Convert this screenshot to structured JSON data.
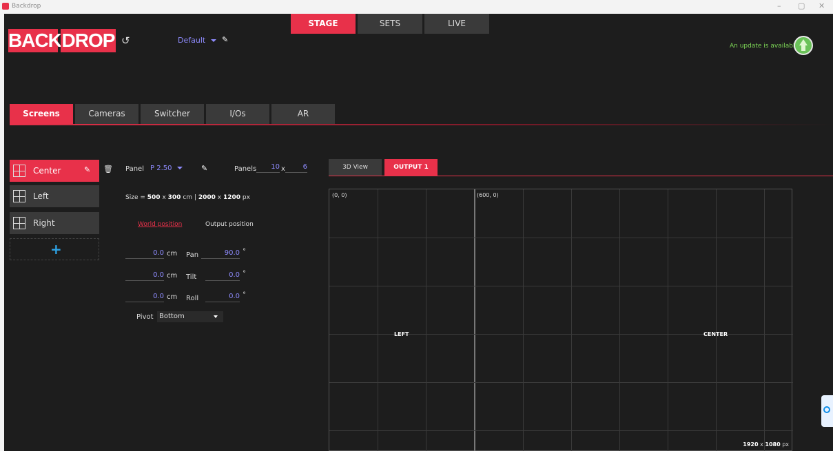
{
  "window": {
    "title": "Backdrop",
    "minimize": "–",
    "maximize": "▢",
    "close": "✕"
  },
  "header": {
    "logo_left": "BACK",
    "logo_right": "DROP",
    "preset": "Default",
    "nav": [
      {
        "label": "STAGE",
        "active": true
      },
      {
        "label": "SETS",
        "active": false
      },
      {
        "label": "LIVE",
        "active": false
      }
    ],
    "update_text": "An update is available"
  },
  "subtabs": [
    {
      "label": "Screens",
      "active": true
    },
    {
      "label": "Cameras",
      "active": false
    },
    {
      "label": "Switcher",
      "active": false
    },
    {
      "label": "I/Os",
      "active": false
    },
    {
      "label": "AR",
      "active": false
    }
  ],
  "screens": [
    {
      "label": "Center",
      "active": true
    },
    {
      "label": "Left",
      "active": false
    },
    {
      "label": "Right",
      "active": false
    }
  ],
  "add_symbol": "+",
  "panel": {
    "panel_label": "Panel",
    "panel_value": "P 2.50",
    "panels_label": "Panels",
    "panels_x": "10",
    "times": "x",
    "panels_y": "6",
    "size_prefix": "Size =",
    "size_w": "500",
    "x1": "x",
    "size_h": "300",
    "unit_cm": "cm",
    "sep": "|",
    "px_w": "2000",
    "x2": "x",
    "px_h": "1200",
    "unit_px": "px",
    "world_position": "World position",
    "output_position": "Output position",
    "rows": [
      {
        "value": "0.0",
        "unit": "cm",
        "label": "Pan",
        "angle": "90.0",
        "deg": "°"
      },
      {
        "value": "0.0",
        "unit": "cm",
        "label": "Tilt",
        "angle": "0.0",
        "deg": "°"
      },
      {
        "value": "0.0",
        "unit": "cm",
        "label": "Roll",
        "angle": "0.0",
        "deg": "°"
      }
    ],
    "pivot_label": "Pivot",
    "pivot_value": "Bottom"
  },
  "view_tabs": [
    {
      "label": "3D View",
      "active": false
    },
    {
      "label": "OUTPUT 1",
      "active": true
    }
  ],
  "output": {
    "origin_label": "(0, 0)",
    "second_label": "(600, 0)",
    "left_label": "LEFT",
    "center_label": "CENTER",
    "res_w": "1920",
    "res_x": "x",
    "res_h": "1080",
    "res_unit": "px"
  },
  "colors": {
    "accent": "#e8314a",
    "value": "#8f8cff",
    "update": "#7ed957"
  }
}
